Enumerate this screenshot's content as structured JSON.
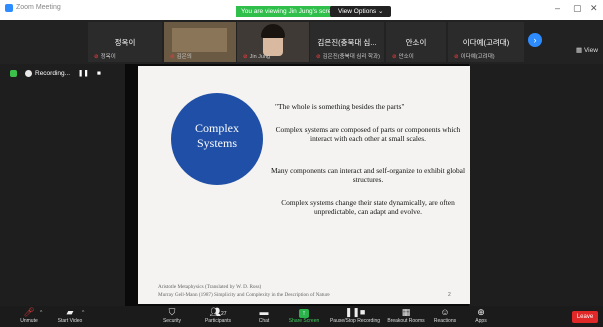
{
  "window": {
    "title": "Zoom Meeting",
    "viewing_banner": "You are viewing Jin Jung's screen",
    "view_options": "View Options ⌄",
    "view_label": "View"
  },
  "participants": [
    {
      "name": "정옥이",
      "sub": "정옥이"
    },
    {
      "name": "",
      "sub": "김은의"
    },
    {
      "name": "",
      "sub": "Jin Jung"
    },
    {
      "name": "김은진(충북대 심...",
      "sub": "김은진(충북대 심리 학과)"
    },
    {
      "name": "안소이",
      "sub": "안소이"
    },
    {
      "name": "이다예(고려대)",
      "sub": "이다예(고려대)"
    }
  ],
  "recording": {
    "label": "Recording...",
    "pause": "❚❚",
    "stop": "■"
  },
  "slide": {
    "circle_line1": "Complex",
    "circle_line2": "Systems",
    "quote": "\"The whole is something besides the parts\"",
    "para1": "Complex systems are composed of parts or components which interact with each other at small scales.",
    "para2": "Many components can interact and self-organize to exhibit global structures.",
    "para3": "Complex systems change their state dynamically, are often unpredictable, can adapt and evolve.",
    "ref1": "Aristotle Metaphysics (Translated by W. D. Ross)",
    "ref2": "Murray Gell-Mann (1987) Simplicity and Complexity in the Description of Nature",
    "page": "2"
  },
  "toolbar": {
    "unmute": "Unmute",
    "start_video": "Start Video",
    "security": "Security",
    "participants": "Participants",
    "participants_count": "27",
    "chat": "Chat",
    "share_screen": "Share Screen",
    "pause_recording": "Pause/Stop Recording",
    "breakout": "Breakout Rooms",
    "reactions": "Reactions",
    "apps": "Apps",
    "leave": "Leave"
  },
  "colors": {
    "share_green": "#2fbf4a",
    "leave_red": "#e02828",
    "accent_blue": "#1f4fa6"
  }
}
